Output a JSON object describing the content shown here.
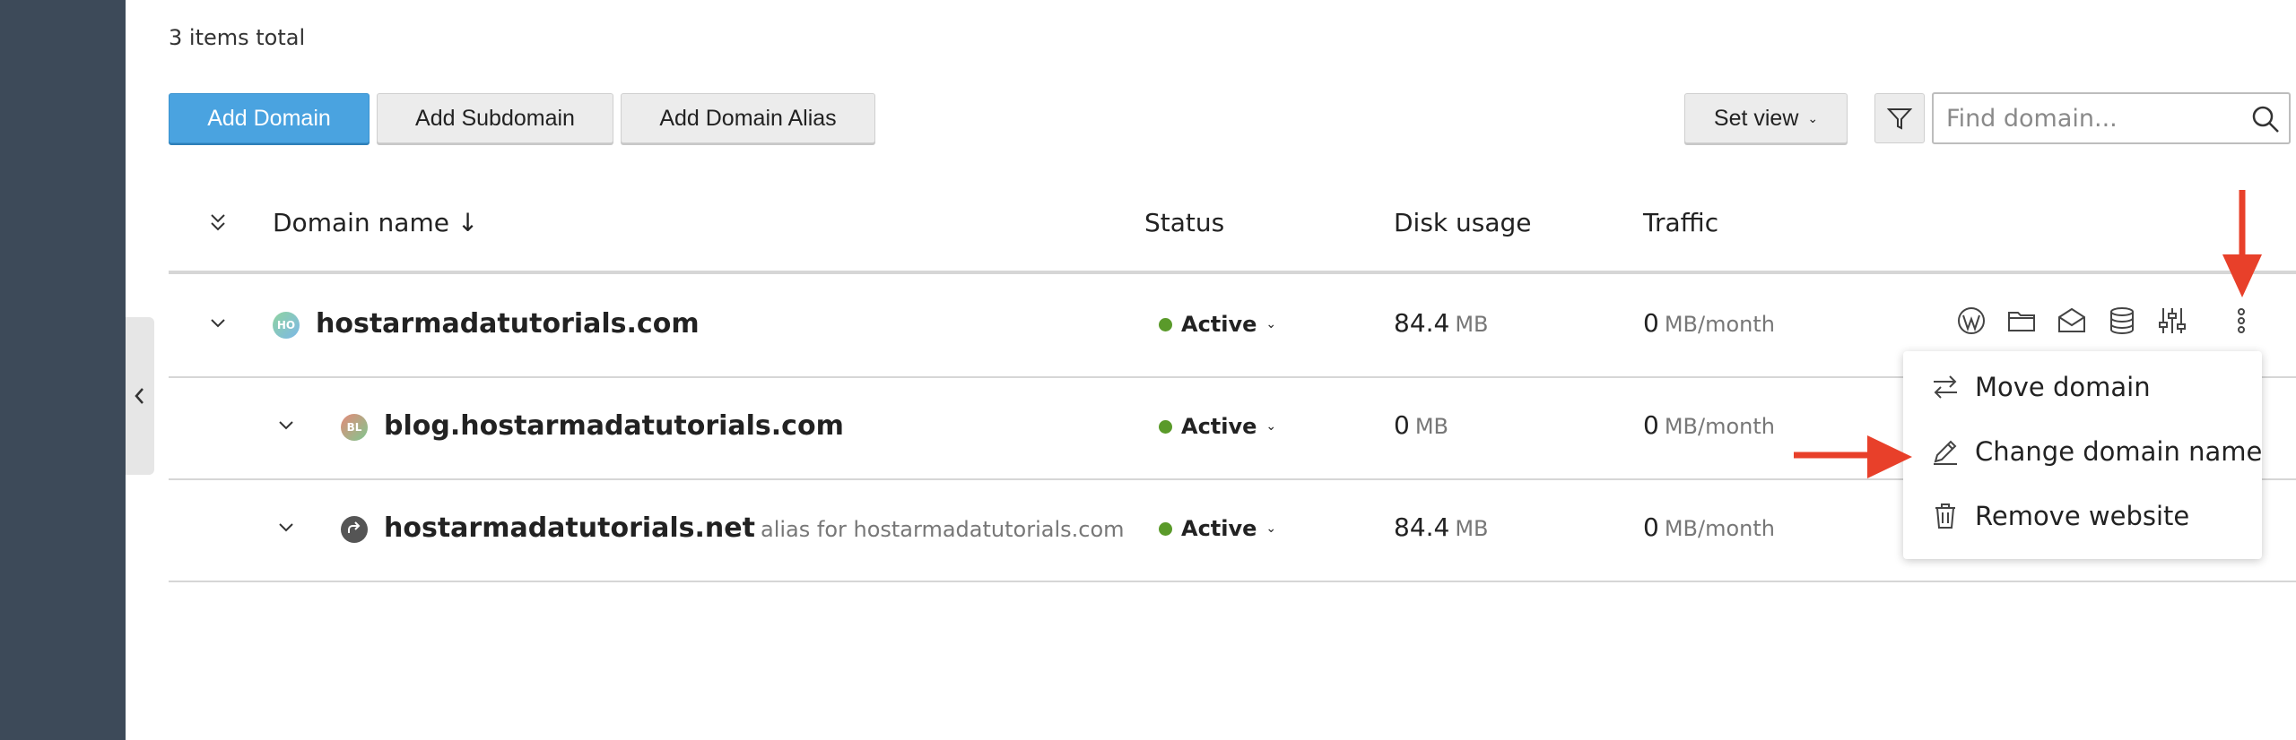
{
  "summary": {
    "items_total": "3 items total"
  },
  "toolbar": {
    "add_domain": "Add Domain",
    "add_subdomain": "Add Subdomain",
    "add_domain_alias": "Add Domain Alias",
    "set_view": "Set view",
    "search_placeholder": "Find domain..."
  },
  "table": {
    "headers": {
      "domain_name": "Domain name ↓",
      "status": "Status",
      "disk_usage": "Disk usage",
      "traffic": "Traffic"
    },
    "rows": [
      {
        "avatar": "HO",
        "name": "hostarmadatutorials.com",
        "alias_note": "",
        "status": "Active",
        "disk_value": "84.4",
        "disk_unit": "MB",
        "traffic_value": "0",
        "traffic_unit": "MB/month"
      },
      {
        "avatar": "BL",
        "name": "blog.hostarmadatutorials.com",
        "alias_note": "",
        "status": "Active",
        "disk_value": "0",
        "disk_unit": "MB",
        "traffic_value": "0",
        "traffic_unit": "MB/month"
      },
      {
        "avatar": "",
        "name": "hostarmadatutorials.net",
        "alias_note": "alias for hostarmadatutorials.com",
        "status": "Active",
        "disk_value": "84.4",
        "disk_unit": "MB",
        "traffic_value": "0",
        "traffic_unit": "MB/month"
      }
    ]
  },
  "dropdown_menu": {
    "items": [
      {
        "label": "Move domain",
        "icon": "arrows-swap-icon"
      },
      {
        "label": "Change domain name",
        "icon": "pencil-icon"
      },
      {
        "label": "Remove website",
        "icon": "trash-icon"
      }
    ]
  },
  "colors": {
    "primary": "#4aa3e0",
    "sidebar": "#3d4a59",
    "status_active": "#5a9a2a",
    "annotation_arrow": "#e8402a"
  }
}
